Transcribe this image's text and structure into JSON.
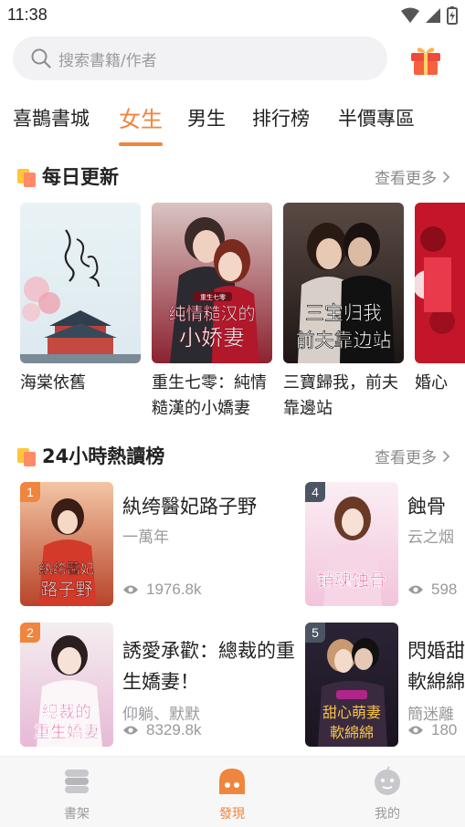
{
  "status": {
    "time": "11:38"
  },
  "search": {
    "placeholder": "搜索書籍/作者"
  },
  "tabs": [
    {
      "label": "喜鵲書城",
      "active": false
    },
    {
      "label": "女生",
      "active": true
    },
    {
      "label": "男生",
      "active": false
    },
    {
      "label": "排行榜",
      "active": false
    },
    {
      "label": "半價專區",
      "active": false
    }
  ],
  "daily": {
    "title": "每日更新",
    "more": "查看更多",
    "books": [
      {
        "title": "海棠依舊"
      },
      {
        "title": "重生七零：純情糙漢的小嬌妻"
      },
      {
        "title": "三寶歸我，前夫靠邊站"
      },
      {
        "title": "婚心"
      }
    ]
  },
  "ranking": {
    "title": "24小時熱讀榜",
    "more": "查看更多",
    "items": [
      {
        "rank": "1",
        "title": "紈绔醫妃路子野",
        "author": "一萬年",
        "views": "1976.8k"
      },
      {
        "rank": "2",
        "title": "誘愛承歡：總裁的重生嬌妻！",
        "author": "仰躺、默默",
        "views": "8329.8k"
      },
      {
        "rank": "4",
        "title": "蝕骨",
        "author": "云之烟",
        "views": "598"
      },
      {
        "rank": "5",
        "title": "閃婚甜妻軟綿綿",
        "author": "簡迷離",
        "views": "180"
      }
    ]
  },
  "colors": {
    "accent": "#f0853d",
    "rank_top": "#f0853d",
    "rank_other": "#4b5563"
  },
  "nav": [
    {
      "label": "書架",
      "icon": "bookshelf-icon",
      "active": false
    },
    {
      "label": "發現",
      "icon": "discover-icon",
      "active": true
    },
    {
      "label": "我的",
      "icon": "profile-icon",
      "active": false
    }
  ]
}
